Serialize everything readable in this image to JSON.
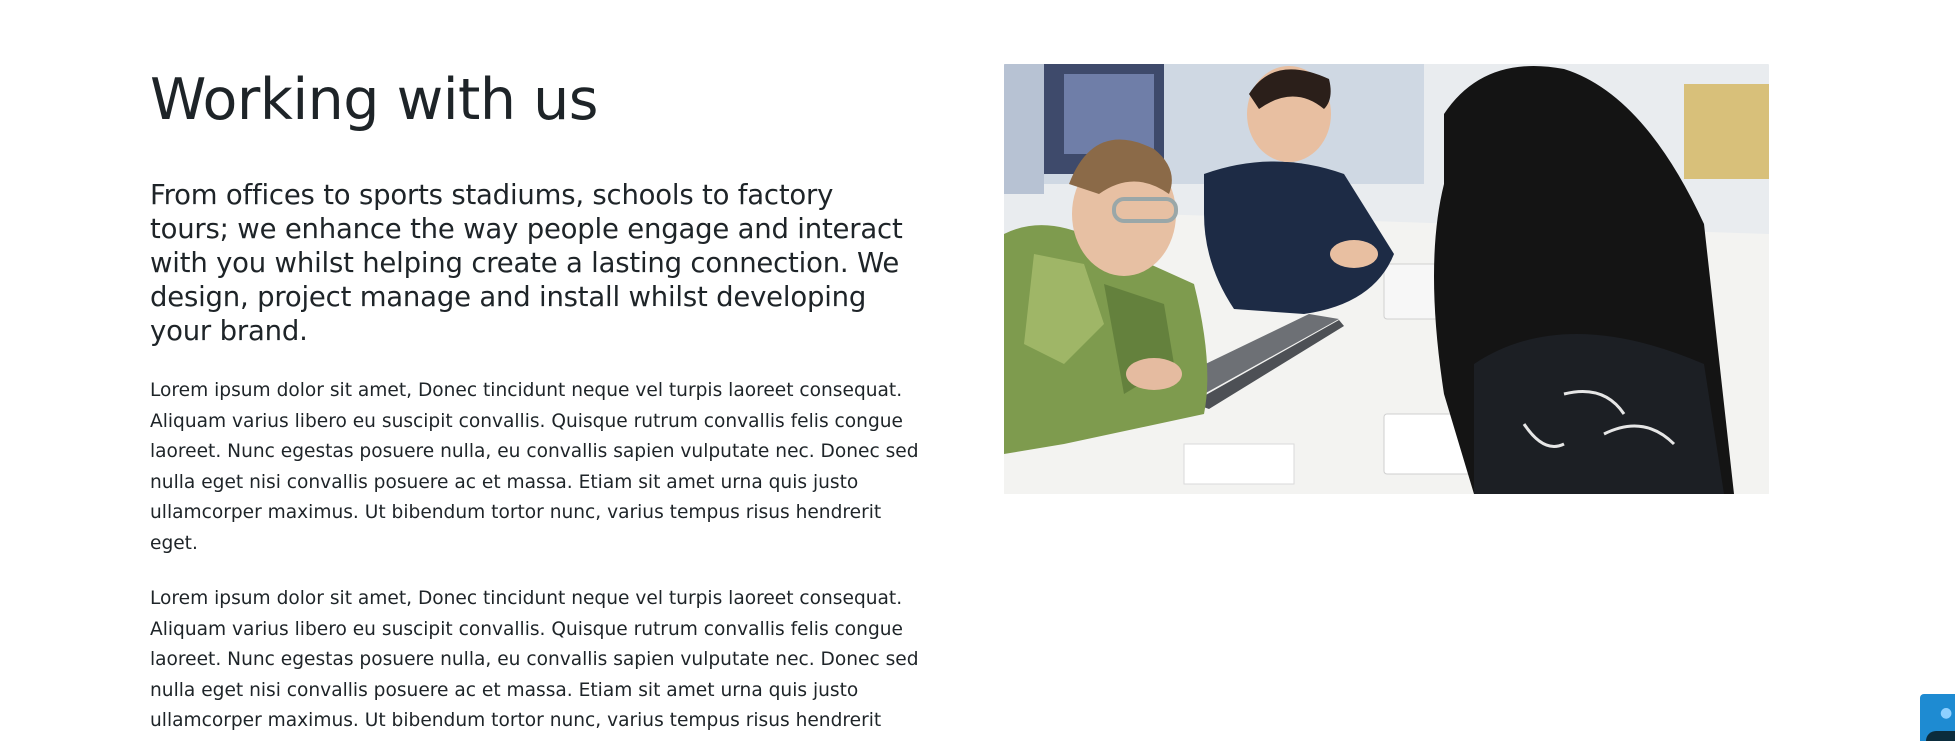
{
  "section": {
    "title": "Working with us",
    "lead": "From offices to sports stadiums, schools to factory tours; we enhance the way people engage and interact with you whilst helping create a lasting connection. We design, project manage and install whilst developing your brand.",
    "paragraphs": [
      "Lorem ipsum dolor sit amet, Donec tincidunt neque vel turpis laoreet consequat. Aliquam varius libero eu suscipit convallis. Quisque rutrum convallis felis congue laoreet. Nunc egestas posuere nulla, eu convallis sapien vulputate nec. Donec sed nulla eget nisi convallis posuere ac et massa. Etiam sit amet urna quis justo ullamcorper maximus. Ut bibendum tortor nunc, varius tempus risus hendrerit eget.",
      "Lorem ipsum dolor sit amet, Donec tincidunt neque vel turpis laoreet consequat. Aliquam varius libero eu suscipit convallis. Quisque rutrum convallis felis congue laoreet. Nunc egestas posuere nulla, eu convallis sapien vulputate nec. Donec sed nulla eget nisi convallis posuere ac et massa. Etiam sit amet urna quis justo ullamcorper maximus. Ut bibendum tortor nunc, varius tempus risus hendrerit eget."
    ]
  },
  "photo": {
    "icon": "team-meeting-photo"
  },
  "widget": {
    "icon": "apple-icon",
    "color": "#1e8bd2"
  },
  "colors": {
    "text": "#1e2428",
    "background": "#ffffff"
  }
}
